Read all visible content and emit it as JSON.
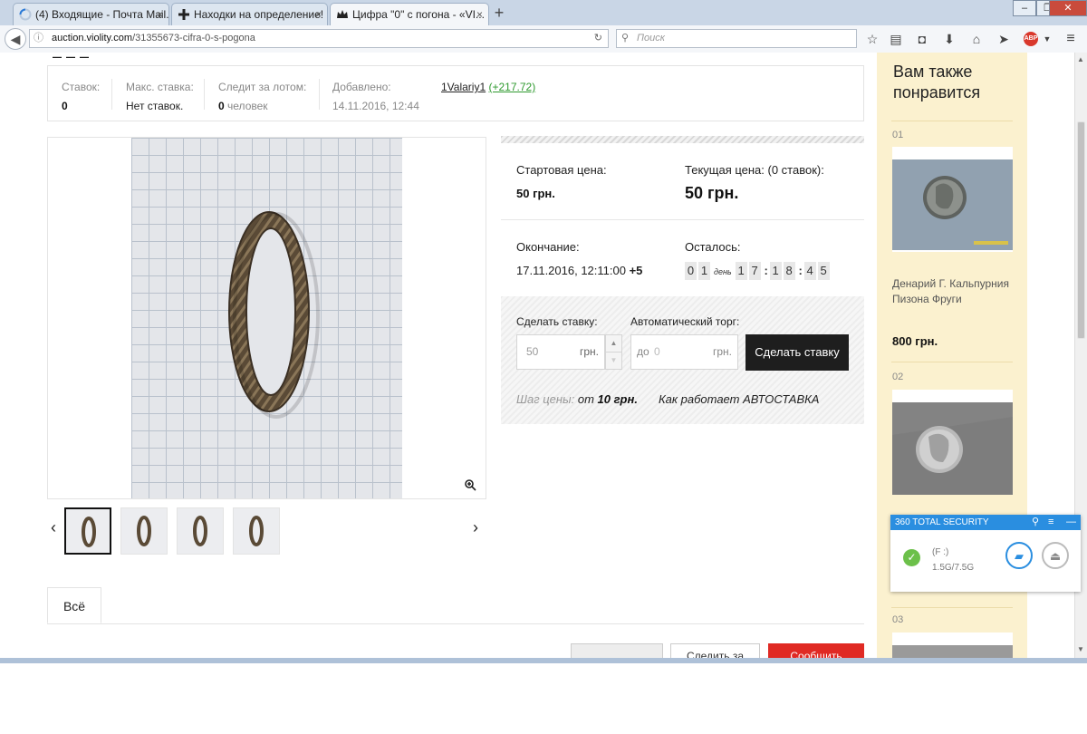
{
  "browser": {
    "tabs": [
      {
        "label": "(4) Входящие - Почта Mail....",
        "icon": "loading-spinner"
      },
      {
        "label": "Находки на определение! ...",
        "icon": "cross-icon"
      },
      {
        "label": "Цифра \"0\" с погона - «VI...",
        "icon": "crown-icon"
      }
    ],
    "new_tab": "+",
    "close_tab": "×",
    "window_controls": {
      "minimize": "‒",
      "maximize": "❐",
      "close": "✕"
    },
    "url_domain": "auction.violity.com",
    "url_path": "/31355673-cifra-0-s-pogona",
    "search_placeholder": "Поиск",
    "abp_label": "ABP"
  },
  "stats": {
    "bids_label": "Ставок:",
    "bids_value": "0",
    "max_bid_label": "Макс. ставка:",
    "max_bid_value": "Нет ставок.",
    "watching_label": "Следит за лотом:",
    "watching_count": "0",
    "watching_unit": "человек",
    "added_label": "Добавлено:",
    "added_value": "14.11.2016, 12:44",
    "seller_name": "1Valariy1",
    "seller_rating": "(+217.72)"
  },
  "price": {
    "start_label": "Стартовая цена:",
    "start_value": "50 грн.",
    "current_label": "Текущая цена: (0 ставок):",
    "current_value": "50 грн.",
    "end_label": "Окончание:",
    "end_value": "17.11.2016, 12:11:00",
    "end_tz": "+5",
    "left_label": "Осталось:",
    "days": [
      "0",
      "1"
    ],
    "day_word": "день",
    "hours": [
      "1",
      "7"
    ],
    "minutes": [
      "1",
      "8"
    ],
    "seconds": [
      "4",
      "5"
    ]
  },
  "bid": {
    "make_bid_label": "Сделать ставку:",
    "bid_value": "50",
    "currency": "грн.",
    "auto_label": "Автоматический торг:",
    "auto_prefix": "до",
    "auto_placeholder": "0",
    "submit_label": "Сделать ставку",
    "step_label": "Шаг цены:",
    "step_from": "от",
    "step_value": "10 грн.",
    "how_link": "Как работает АВТОСТАВКА",
    "stepper_up": "▲",
    "stepper_down": "▼"
  },
  "gallery": {
    "prev": "‹",
    "next": "›"
  },
  "tabs_bottom": {
    "all_label": "Всё"
  },
  "bottom_buttons": {
    "watch_label": "Следить за",
    "report_label": "Сообщить"
  },
  "sidebar": {
    "title_line1": "Вам также",
    "title_line2": "понравится",
    "items": [
      {
        "num": "01",
        "title": "Денарий Г. Кальпурния Пизона Фруги",
        "price": "800 грн."
      },
      {
        "num": "02"
      },
      {
        "num": "03"
      }
    ]
  },
  "security_popup": {
    "title": "360 TOTAL SECURITY",
    "drive": "(F :)",
    "usage": "1.5G/7.5G"
  },
  "colors": {
    "accent_green": "#2f9a2f",
    "sidebar_bg": "#fbf1cf",
    "bid_button": "#1e1e1e",
    "report_button": "#e02a24",
    "security_blue": "#2a8ee0"
  }
}
